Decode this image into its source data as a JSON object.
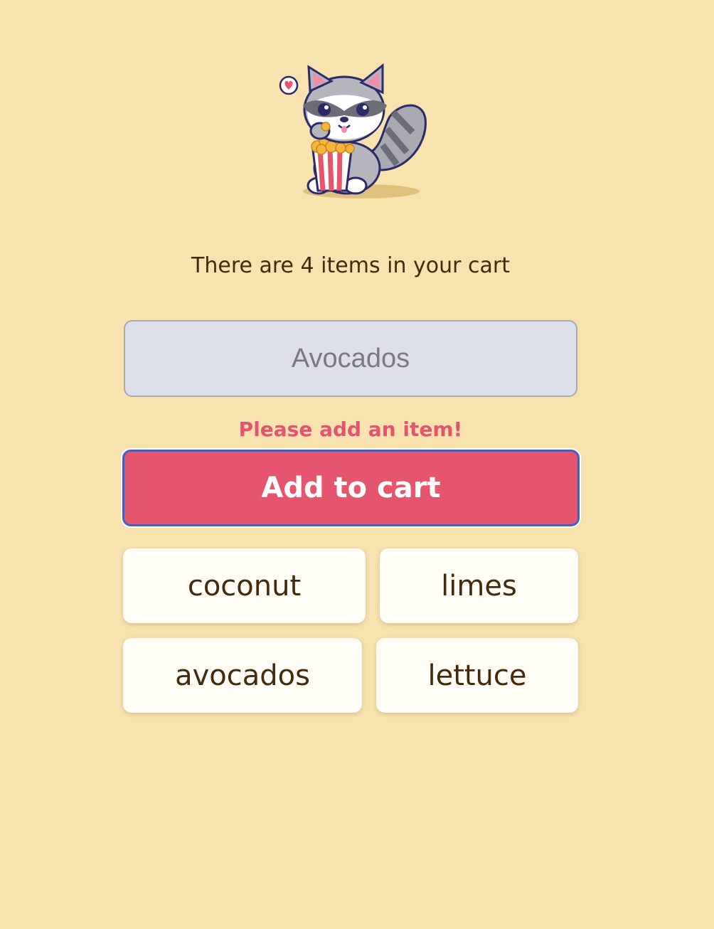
{
  "mascot": {
    "icon": "raccoon-eating-popcorn-illustration"
  },
  "cart": {
    "status_text": "There are 4 items in your cart"
  },
  "input": {
    "placeholder": "Avocados",
    "value": ""
  },
  "error": {
    "message": "Please add an item!"
  },
  "add_button": {
    "label": "Add to cart"
  },
  "items": [
    "coconut",
    "limes",
    "avocados",
    "lettuce"
  ],
  "colors": {
    "background": "#f8e2ae",
    "accent": "#e5556e",
    "focus_ring": "#3e61c7",
    "text": "#432a0c",
    "input_bg": "#dde0ea",
    "chip_bg": "#fffdf6"
  }
}
